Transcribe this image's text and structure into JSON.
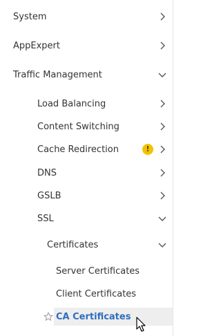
{
  "nav": {
    "items": [
      {
        "label": "System",
        "state": "collapsed"
      },
      {
        "label": "AppExpert",
        "state": "collapsed"
      },
      {
        "label": "Traffic Management",
        "state": "expanded"
      },
      {
        "label": "Load Balancing",
        "state": "collapsed"
      },
      {
        "label": "Content Switching",
        "state": "collapsed"
      },
      {
        "label": "Cache Redirection",
        "state": "collapsed",
        "warning": "!"
      },
      {
        "label": "DNS",
        "state": "collapsed"
      },
      {
        "label": "GSLB",
        "state": "collapsed"
      },
      {
        "label": "SSL",
        "state": "expanded"
      },
      {
        "label": "Certificates",
        "state": "expanded"
      },
      {
        "label": "Server Certificates",
        "state": "leaf"
      },
      {
        "label": "Client Certificates",
        "state": "leaf"
      },
      {
        "label": "CA Certificates",
        "state": "selected"
      }
    ]
  },
  "colors": {
    "selected_text": "#2f6ebd",
    "selected_bg": "#eeeeee",
    "warning": "#f2c200",
    "chevron": "#555555"
  },
  "icons": {
    "expand": "chevron-right-icon",
    "collapse": "chevron-down-icon",
    "warning": "warning-icon",
    "favorite": "star-icon",
    "cursor": "mouse-cursor-icon"
  }
}
